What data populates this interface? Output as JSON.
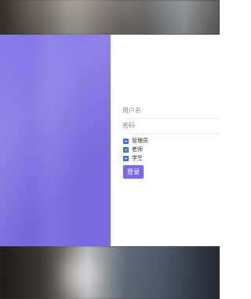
{
  "login": {
    "username_placeholder": "用户名",
    "password_placeholder": "密码",
    "roles": [
      {
        "label": "管理员",
        "checked": true
      },
      {
        "label": "老师",
        "checked": true
      },
      {
        "label": "学生",
        "checked": true
      }
    ],
    "submit_label": "登录"
  },
  "colors": {
    "left_panel": "#7a6ce8",
    "button": "#7a68e6",
    "checkbox": "#3b78e7"
  },
  "icons": {
    "checkbox": "checkbox-checked-icon"
  }
}
